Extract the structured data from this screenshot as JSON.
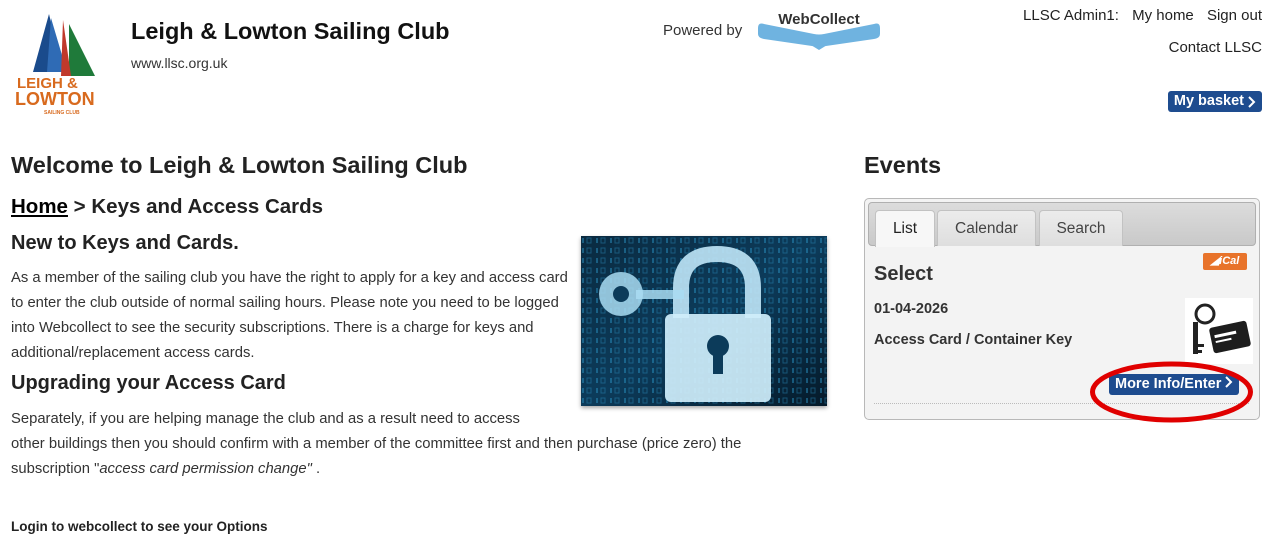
{
  "header": {
    "club_name": "Leigh & Lowton Sailing Club",
    "club_url": "www.llsc.org.uk",
    "logo_text_line1": "LEIGH &",
    "logo_text_line2": "LOWTON",
    "logo_text_line3": "SAILING CLUB",
    "powered_by": "Powered by",
    "webcollect_logo": "WebCollect",
    "user_label": "LLSC Admin1:",
    "my_home": "My home",
    "sign_out": "Sign out",
    "contact": "Contact LLSC",
    "basket": "My basket",
    "basket_icon": "chevron-right-icon"
  },
  "main": {
    "welcome": "Welcome to Leigh & Lowton Sailing Club",
    "breadcrumb": {
      "home": "Home",
      "separator": ">",
      "current": "Keys and Access Cards"
    },
    "section1": {
      "heading": "New to Keys and Cards.",
      "text": "As a member of the sailing club you have the right to apply for a key and access card to enter the club outside of normal sailing hours. Please note you need to be logged into Webcollect to see the security subscriptions. There is a charge for keys and additional/replacement access cards."
    },
    "section2": {
      "heading": "Upgrading your Access Card",
      "text_line1": "Separately, if you are helping manage the club and as a result need to access",
      "text_rest_before": "other buildings then you should confirm with a member of the committee first and then purchase (price zero) the subscription \"",
      "text_emphasis": "access card permission change\"",
      "text_after": " ."
    },
    "login_note": "Login to webcollect to see your Options",
    "image_icon": "padlock-key-icon"
  },
  "events": {
    "title": "Events",
    "tabs": [
      {
        "label": "List",
        "active": true
      },
      {
        "label": "Calendar",
        "active": false
      },
      {
        "label": "Search",
        "active": false
      }
    ],
    "ical": "iCal",
    "ical_icon": "rss-icon",
    "select": "Select",
    "item": {
      "date": "01-04-2026",
      "name": "Access Card / Container Key",
      "image_icon": "key-card-icon",
      "button": "More Info/Enter",
      "button_icon": "chevron-right-icon"
    }
  },
  "colors": {
    "button_blue": "#1e4c8f",
    "highlight_red": "#e00000",
    "ical_orange": "#e8732a"
  }
}
